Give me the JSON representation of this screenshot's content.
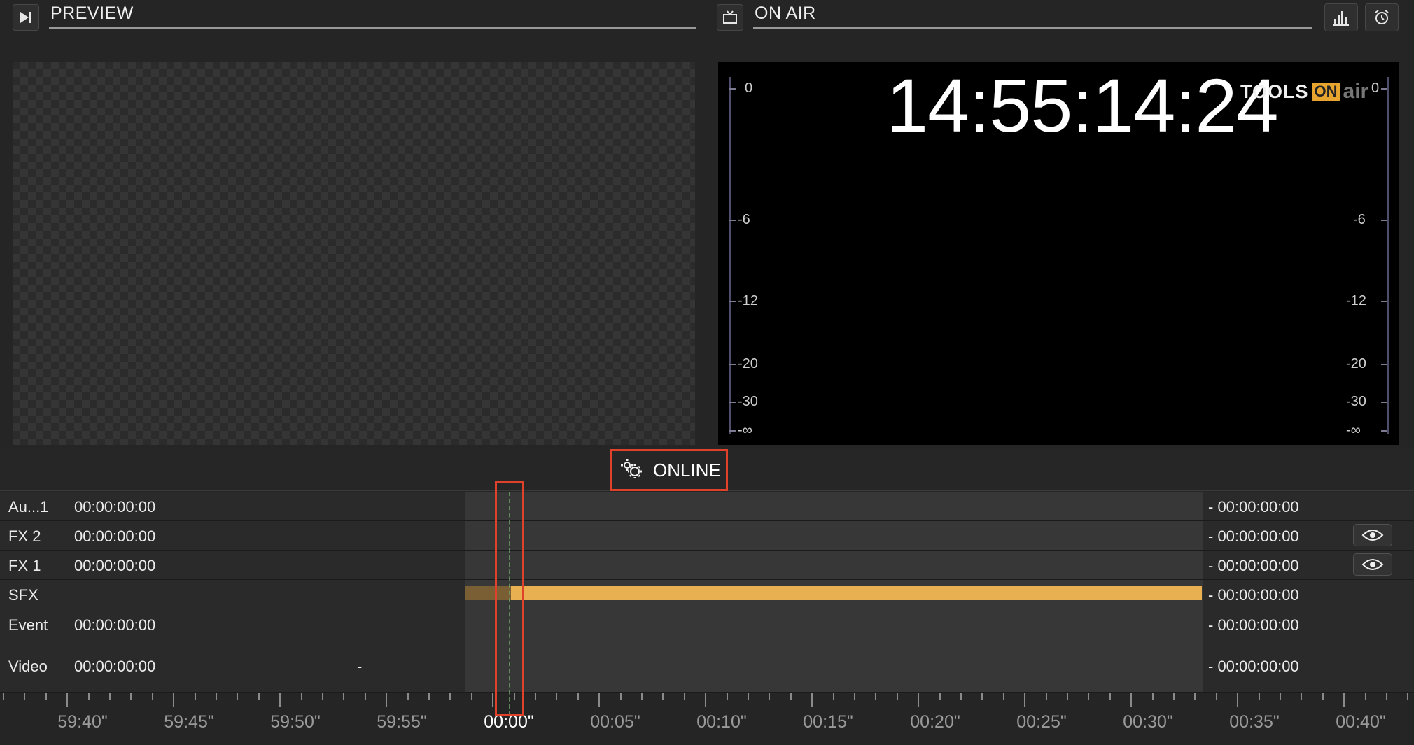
{
  "preview": {
    "title": "PREVIEW",
    "icon": "play-next-icon"
  },
  "on_air": {
    "title": "ON AIR",
    "icon": "tv-icon",
    "clock": "14:55:14:24",
    "logo": {
      "tools": "TOOLS",
      "on": "ON",
      "air": "air"
    },
    "meter_labels": [
      "0",
      "-6",
      "-12",
      "-20",
      "-30",
      "-∞"
    ],
    "buttons": {
      "stats": "bar-chart-icon",
      "alarm": "alarm-clock-icon"
    }
  },
  "status": {
    "label": "ONLINE",
    "icon": "gears-icon",
    "highlight_color": "#e0412b"
  },
  "tracks": [
    {
      "name": "Au...1",
      "timecode": "00:00:00:00",
      "end": "- 00:00:00:00",
      "eye": false
    },
    {
      "name": "FX 2",
      "timecode": "00:00:00:00",
      "end": "- 00:00:00:00",
      "eye": true
    },
    {
      "name": "FX 1",
      "timecode": "00:00:00:00",
      "end": "- 00:00:00:00",
      "eye": true
    },
    {
      "name": "SFX",
      "timecode": "",
      "end": "- 00:00:00:00",
      "eye": false,
      "clip_color": "#e8b050"
    },
    {
      "name": "Event",
      "timecode": "00:00:00:00",
      "end": "- 00:00:00:00",
      "eye": false
    },
    {
      "name": "Video",
      "timecode": "00:00:00:00",
      "dash": "-",
      "end": "- 00:00:00:00",
      "eye": false
    }
  ],
  "ruler": {
    "labels": [
      "59:40\"",
      "59:45\"",
      "59:50\"",
      "59:55\"",
      "00:00\"",
      "00:05\"",
      "00:10\"",
      "00:15\"",
      "00:20\"",
      "00:25\"",
      "00:30\"",
      "00:35\"",
      "00:40\""
    ],
    "current": "00:00\""
  }
}
